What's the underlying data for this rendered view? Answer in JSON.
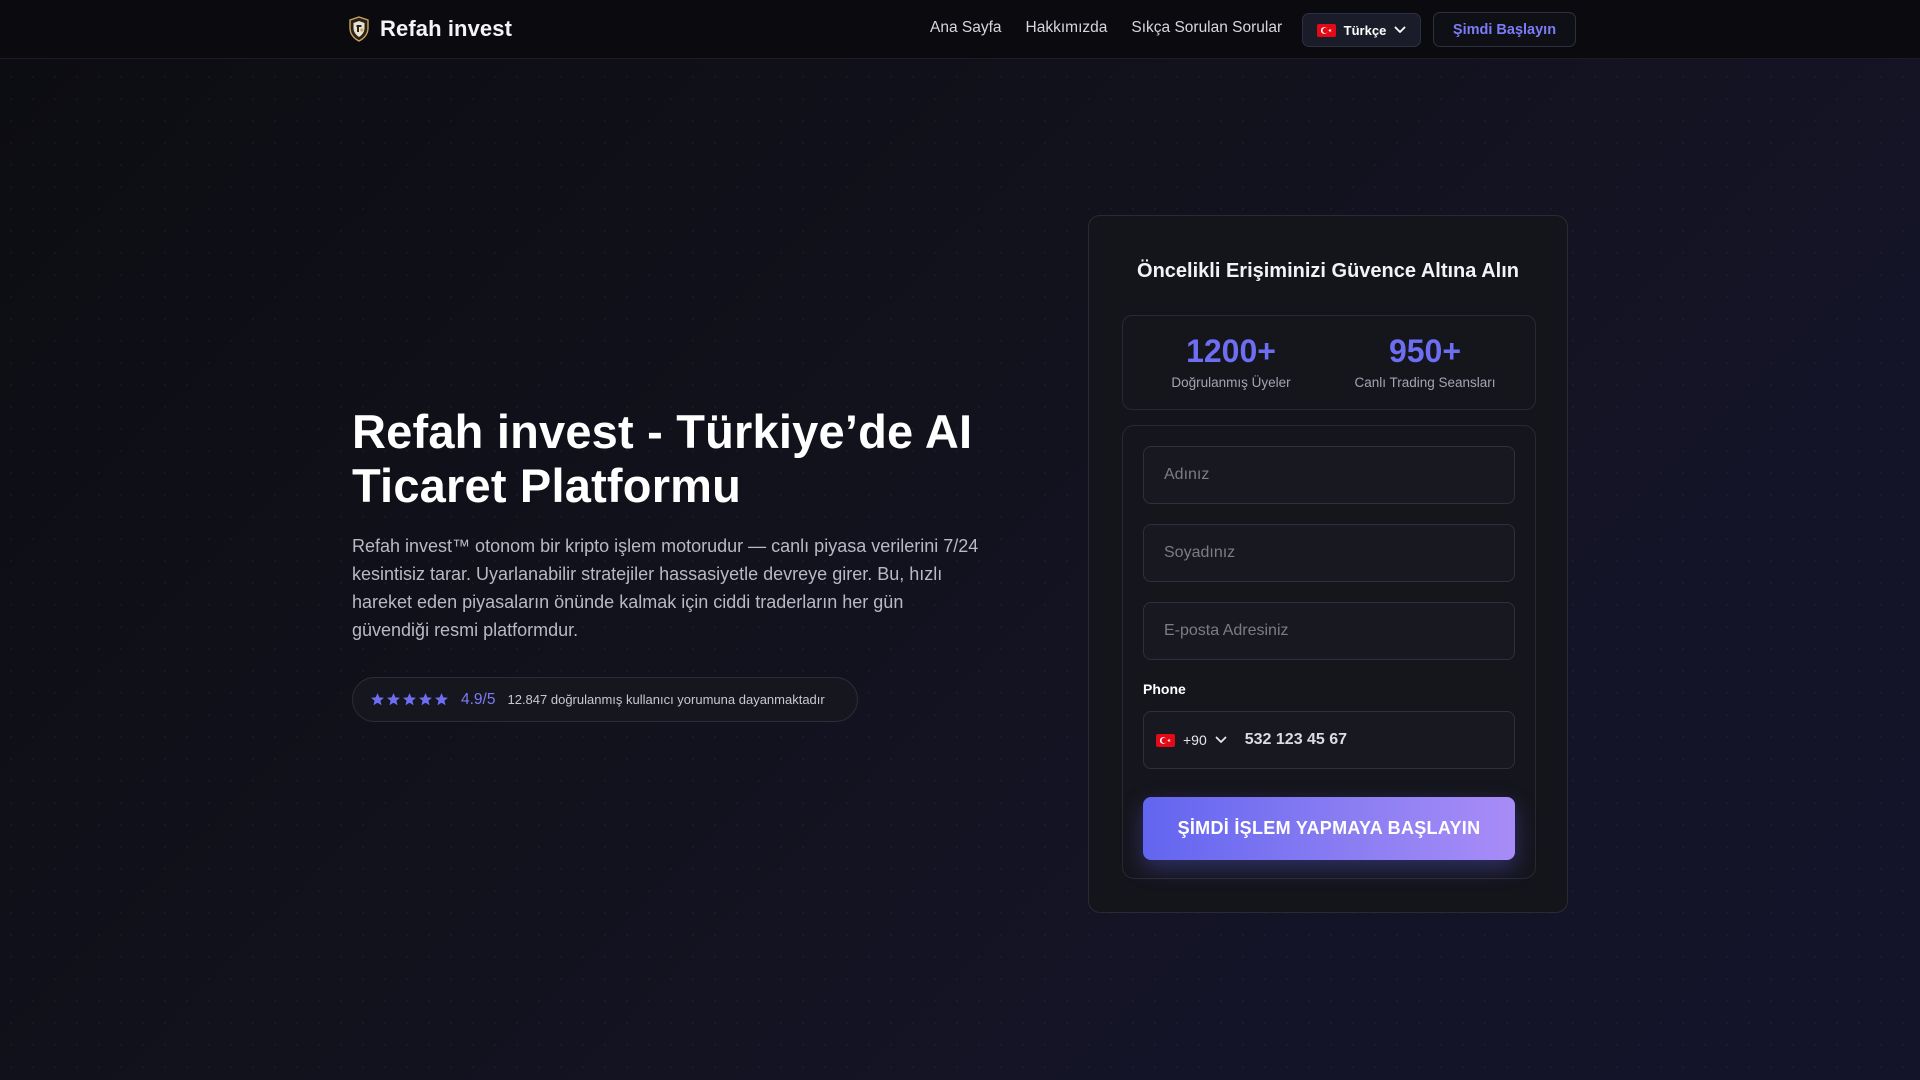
{
  "header": {
    "brand_name": "Refah invest",
    "nav": [
      "Ana Sayfa",
      "Hakkımızda",
      "Sıkça Sorulan Sorular"
    ],
    "language_label": "Türkçe",
    "cta_label": "Şimdi Başlayın"
  },
  "hero": {
    "title": "Refah invest - Türkiye’de AI Ticaret Platformu",
    "description": "Refah invest™ otonom bir kripto işlem motorudur — canlı piyasa verilerini 7/24 kesintisiz tarar. Uyarlanabilir stratejiler hassasiyetle devreye girer. Bu, hızlı hareket eden piyasaların önünde kalmak için ciddi traderların her gün güvendiği resmi platformdur.",
    "rating": {
      "stars": 5,
      "score": "4.9/5",
      "text": "12.847 doğrulanmış kullanıcı yorumuna dayanmaktadır"
    }
  },
  "form": {
    "title": "Öncelikli Erişiminizi Güvence Altına Alın",
    "stats": [
      {
        "value": "1200+",
        "label": "Doğrulanmış Üyeler"
      },
      {
        "value": "950+",
        "label": "Canlı Trading Seansları"
      }
    ],
    "first_name_placeholder": "Adınız",
    "last_name_placeholder": "Soyadınız",
    "email_placeholder": "E-posta Adresiniz",
    "phone_label": "Phone",
    "country_code": "+90",
    "phone_placeholder": "532 123 45 67",
    "submit_label": "ŞİMDİ İŞLEM YAPMAYA BAŞLAYIN"
  },
  "colors": {
    "accent": "#6d6ef2",
    "button_gradient_start": "#6265f0",
    "button_gradient_end": "#a88cf7",
    "background": "#0f0f17"
  },
  "icons": [
    "brand-shield-logo",
    "turkey-flag",
    "chevron-down",
    "star"
  ]
}
